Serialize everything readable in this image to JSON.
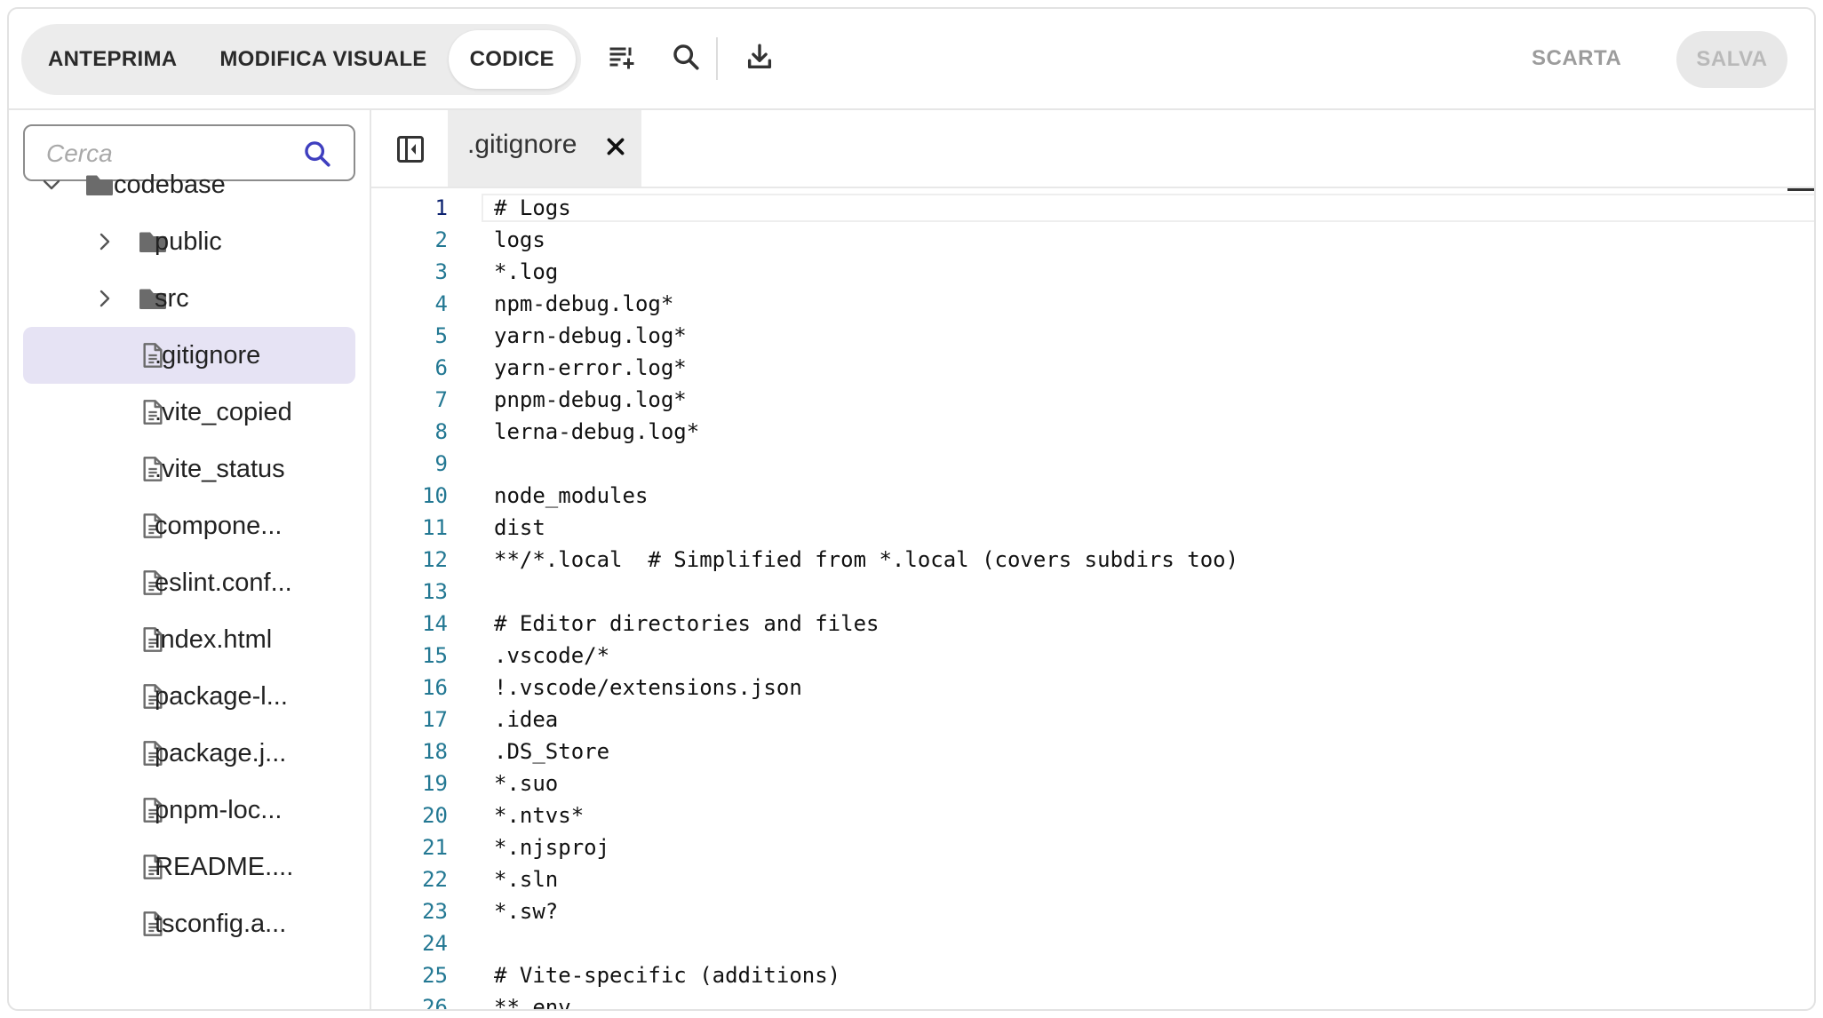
{
  "toolbar": {
    "modes": [
      {
        "label": "ANTEPRIMA",
        "active": false
      },
      {
        "label": "MODIFICA VISUALE",
        "active": false
      },
      {
        "label": "CODICE",
        "active": true
      }
    ],
    "icons": [
      "add-to-list-icon",
      "search-icon",
      "download-icon"
    ],
    "discard_label": "SCARTA",
    "save_label": "SALVA"
  },
  "sidebar": {
    "search_placeholder": "Cerca",
    "tree": [
      {
        "label": "codebase",
        "type": "folder",
        "expanded": true,
        "depth": 0
      },
      {
        "label": "public",
        "type": "folder",
        "expanded": false,
        "depth": 1
      },
      {
        "label": "src",
        "type": "folder",
        "expanded": false,
        "depth": 1
      },
      {
        "label": ".gitignore",
        "type": "file",
        "selected": true,
        "depth": 1
      },
      {
        "label": ".vite_copied",
        "type": "file",
        "depth": 1
      },
      {
        "label": ".vite_status",
        "type": "file",
        "depth": 1
      },
      {
        "label": "compone...",
        "type": "file",
        "depth": 1
      },
      {
        "label": "eslint.conf...",
        "type": "file",
        "depth": 1
      },
      {
        "label": "index.html",
        "type": "file",
        "depth": 1
      },
      {
        "label": "package-l...",
        "type": "file",
        "depth": 1
      },
      {
        "label": "package.j...",
        "type": "file",
        "depth": 1
      },
      {
        "label": "pnpm-loc...",
        "type": "file",
        "depth": 1
      },
      {
        "label": "README....",
        "type": "file",
        "depth": 1
      },
      {
        "label": "tsconfig.a...",
        "type": "file",
        "depth": 1
      }
    ]
  },
  "editor": {
    "tab_name": ".gitignore",
    "active_line": 1,
    "lines": [
      "# Logs",
      "logs",
      "*.log",
      "npm-debug.log*",
      "yarn-debug.log*",
      "yarn-error.log*",
      "pnpm-debug.log*",
      "lerna-debug.log*",
      "",
      "node_modules",
      "dist",
      "**/*.local  # Simplified from *.local (covers subdirs too)",
      "",
      "# Editor directories and files",
      ".vscode/*",
      "!.vscode/extensions.json",
      ".idea",
      ".DS_Store",
      "*.suo",
      "*.ntvs*",
      "*.njsproj",
      "*.sln",
      "*.sw?",
      "",
      "# Vite-specific (additions)",
      "**.env"
    ]
  },
  "colors": {
    "accent": "#3f3fbf",
    "selected_bg": "#e6e3f4",
    "line_number": "#237893",
    "active_line_number": "#0b216f",
    "folder": "#6b6b6b"
  }
}
